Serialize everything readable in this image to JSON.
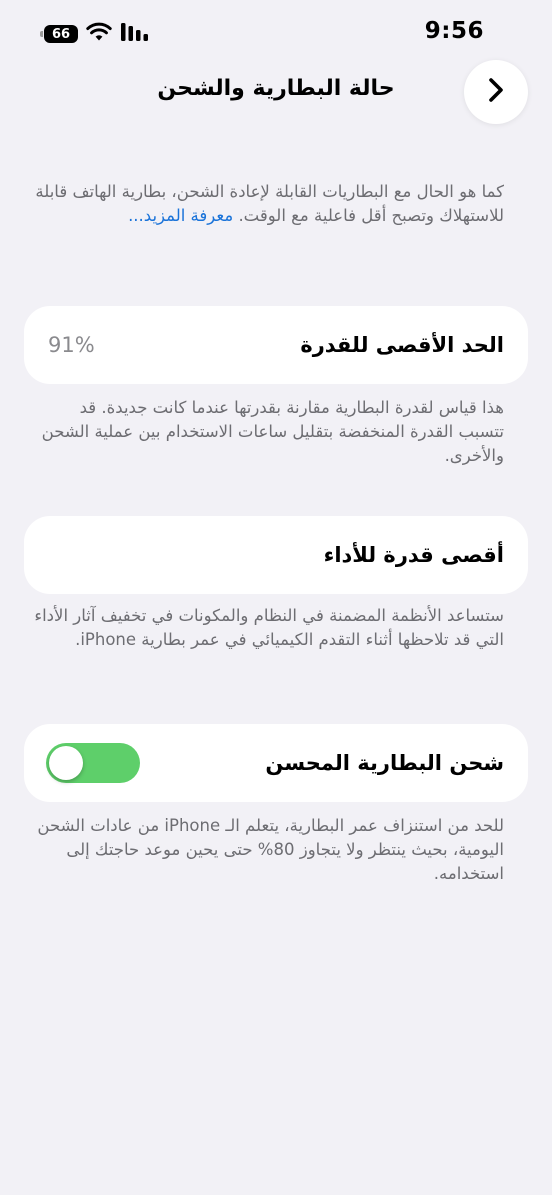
{
  "status_bar": {
    "time": "9:56",
    "battery_level": "66",
    "icons": [
      "battery-icon",
      "wifi-icon",
      "signal-icon"
    ]
  },
  "nav": {
    "title": "حالة البطارية والشحن",
    "back_icon": "chevron-right-icon"
  },
  "intro": {
    "text": "كما هو الحال مع البطاريات القابلة لإعادة الشحن، بطارية الهاتف قابلة للاستهلاك وتصبح أقل فاعلية مع الوقت.",
    "link": "معرفة المزيد..."
  },
  "max_capacity": {
    "label": "الحد الأقصى للقدرة",
    "value": "91%",
    "description": "هذا قياس لقدرة البطارية مقارنة بقدرتها عندما كانت جديدة. قد تتسبب القدرة المنخفضة بتقليل ساعات الاستخدام بين عملية الشحن والأخرى."
  },
  "peak_performance": {
    "label": "أقصى قدرة للأداء",
    "description": "ستساعد الأنظمة المضمنة في النظام والمكونات في تخفيف آثار الأداء التي قد تلاحظها أثناء التقدم الكيميائي في عمر بطارية iPhone."
  },
  "optimized_charging": {
    "label": "شحن البطارية المحسن",
    "enabled": true,
    "description": "للحد من استنزاف عمر البطارية، يتعلم الـ iPhone من عادات الشحن اليومية، بحيث ينتظر ولا يتجاوز 80% حتى يحين موعد حاجتك إلى استخدامه."
  },
  "colors": {
    "background": "#f2f1f6",
    "card": "#ffffff",
    "secondary_text": "#6d6d72",
    "link": "#1a73d9",
    "toggle_on": "#5ecf6a"
  }
}
